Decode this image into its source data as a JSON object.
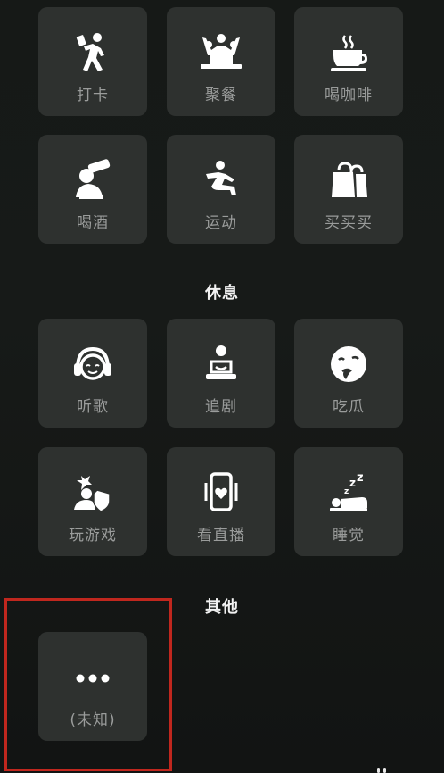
{
  "sections": {
    "rest_title": "休息",
    "other_title": "其他"
  },
  "tiles": [
    {
      "label": "打卡",
      "icon": "walking-person-icon"
    },
    {
      "label": "聚餐",
      "icon": "group-dinner-icon"
    },
    {
      "label": "喝咖啡",
      "icon": "coffee-cup-icon"
    },
    {
      "label": "喝酒",
      "icon": "drinking-bottle-icon"
    },
    {
      "label": "运动",
      "icon": "running-person-icon"
    },
    {
      "label": "买买买",
      "icon": "shopping-bags-icon"
    },
    {
      "label": "听歌",
      "icon": "headphones-face-icon"
    },
    {
      "label": "追剧",
      "icon": "watching-tv-icon"
    },
    {
      "label": "吃瓜",
      "icon": "thinking-face-icon"
    },
    {
      "label": "玩游戏",
      "icon": "gaming-shield-icon"
    },
    {
      "label": "看直播",
      "icon": "live-stream-phone-icon"
    },
    {
      "label": "睡觉",
      "icon": "sleeping-icon"
    },
    {
      "label": "(未知)",
      "icon": "more-dots-icon"
    }
  ],
  "colors": {
    "background": "#161917",
    "tile": "#2e312f",
    "icon": "#ffffff",
    "label": "#9a9c9b",
    "highlight": "#c0271e"
  }
}
